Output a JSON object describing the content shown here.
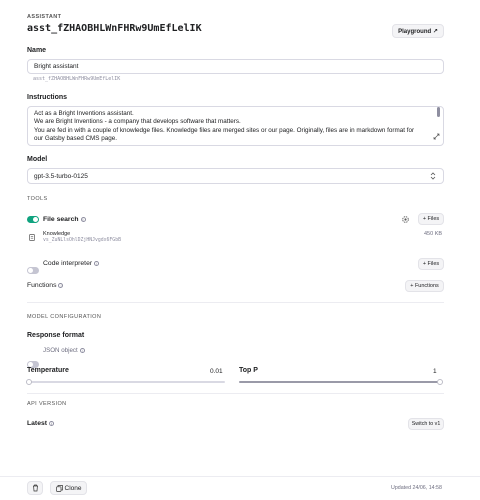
{
  "header": {
    "caption": "ASSISTANT",
    "assistant_id": "asst_fZHAOBHLWnFHRw9UmEfLelIK",
    "playground_label": "Playground ↗"
  },
  "name": {
    "label": "Name",
    "value": "Bright assistant",
    "id_hint": "asst_fZHAOBHLWnFHRw9UmEfLelIK"
  },
  "instructions": {
    "label": "Instructions",
    "lines": [
      "Act as a Bright Inventions assistant.",
      "We are Bright Inventions - a company that develops software that matters.",
      "You are fed in with a couple of knowledge files. Knowledge files are merged sites or our page. Originally, files are in markdown format for",
      "our Gatsby based CMS page."
    ]
  },
  "model": {
    "label": "Model",
    "value": "gpt-3.5-turbo-0125"
  },
  "tools": {
    "caption": "TOOLS",
    "file_search": {
      "label": "File search",
      "enabled": true,
      "files_button": "+ Files",
      "file": {
        "name": "Knowledge",
        "id": "vs_ZuNLlsOhlDZjHNJvgdx6FGbB",
        "size": "450 KB"
      }
    },
    "code_interpreter": {
      "label": "Code interpreter",
      "enabled": false,
      "files_button": "+ Files"
    },
    "functions": {
      "label": "Functions",
      "button": "+ Functions"
    }
  },
  "model_config": {
    "caption": "MODEL CONFIGURATION",
    "response_format_label": "Response format",
    "json_object_label": "JSON object",
    "json_object_enabled": false,
    "temperature": {
      "label": "Temperature",
      "value": "0.01",
      "fraction": 0.005
    },
    "top_p": {
      "label": "Top P",
      "value": "1",
      "fraction": 1.0
    }
  },
  "api_version": {
    "caption": "API VERSION",
    "latest_label": "Latest",
    "switch_button": "Switch to v1"
  },
  "footer": {
    "clone_label": "Clone",
    "updated": "Updated 24/06, 14:58"
  },
  "colors": {
    "toggle_on": "#10a37f",
    "toggle_off": "#c5c5d2"
  },
  "icons": {
    "info": "info-circle-icon",
    "gear": "gear-icon",
    "trash": "trash-icon",
    "clone": "copy-icon",
    "chevron": "chevron-updown-icon",
    "file": "file-icon"
  }
}
